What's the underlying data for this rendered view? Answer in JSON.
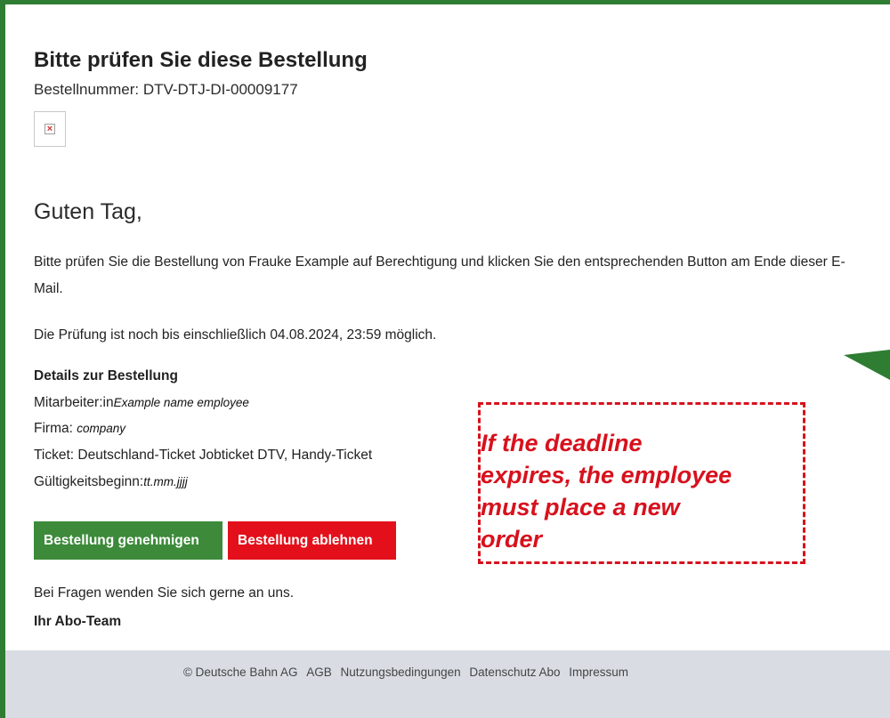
{
  "email": {
    "title": "Bitte prüfen Sie diese Bestellung",
    "order_number": "Bestellnummer: DTV-DTJ-DI-00009177",
    "greeting": "Guten Tag,",
    "intro": "Bitte prüfen Sie die Bestellung von Frauke Example auf Berechtigung und klicken Sie den entsprechenden Button am Ende dieser E-Mail.",
    "deadline": "Die Prüfung ist noch bis einschließlich 04.08.2024, 23:59 möglich.",
    "details": {
      "heading": "Details zur Bestellung",
      "employee_label": "Mitarbeiter:in",
      "employee_value": "Example name employee",
      "company_label": "Firma: ",
      "company_value": "company",
      "ticket": "Ticket: Deutschland-Ticket Jobticket DTV, Handy-Ticket",
      "validity_label": "Gültigkeitsbeginn:",
      "validity_value": "tt.mm.jjjj"
    },
    "buttons": {
      "approve": "Bestellung genehmigen",
      "reject": "Bestellung ablehnen"
    },
    "closing": "Bei Fragen wenden Sie sich gerne an uns.",
    "signature": "Ihr Abo-Team"
  },
  "footer": {
    "copyright": "© Deutsche Bahn AG",
    "links": [
      "AGB",
      "Nutzungsbedingungen",
      "Datenschutz Abo",
      "Impressum"
    ]
  },
  "annotation": {
    "text": "If the deadline\nexpires, the employee\nmust place a new\norder"
  },
  "colors": {
    "frame": "#2e7d32",
    "approve": "#3c8a3a",
    "reject": "#e3101b",
    "annotation": "#d7111d",
    "footer_bg": "#d9dde3"
  }
}
